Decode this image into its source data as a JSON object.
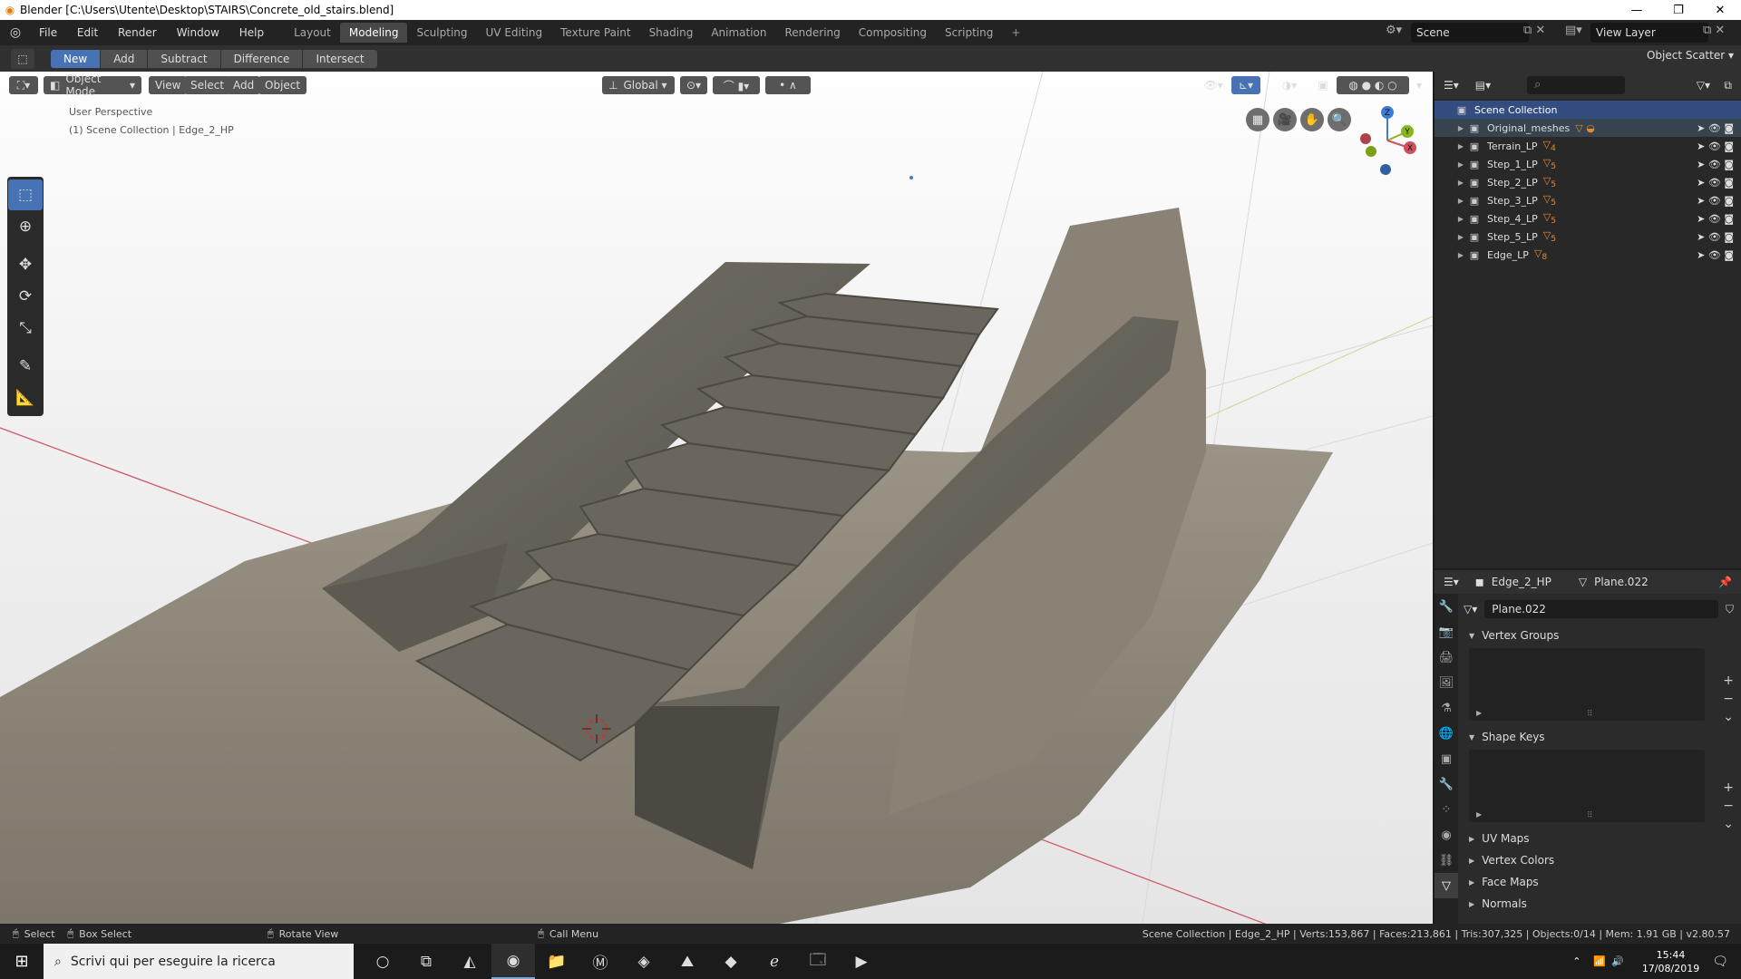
{
  "window": {
    "title": "Blender [C:\\Users\\Utente\\Desktop\\STAIRS\\Concrete_old_stairs.blend]",
    "controls": [
      "—",
      "❐",
      "✕"
    ]
  },
  "menu": [
    "File",
    "Edit",
    "Render",
    "Window",
    "Help"
  ],
  "workspaces": [
    {
      "label": "Layout",
      "active": false
    },
    {
      "label": "Modeling",
      "active": true
    },
    {
      "label": "Sculpting",
      "active": false
    },
    {
      "label": "UV Editing",
      "active": false
    },
    {
      "label": "Texture Paint",
      "active": false
    },
    {
      "label": "Shading",
      "active": false
    },
    {
      "label": "Animation",
      "active": false
    },
    {
      "label": "Rendering",
      "active": false
    },
    {
      "label": "Compositing",
      "active": false
    },
    {
      "label": "Scripting",
      "active": false
    }
  ],
  "workspace_add": "+",
  "scene": "Scene",
  "view_layer": "View Layer",
  "tool_header": {
    "boolean_ops": [
      "New",
      "Add",
      "Subtract",
      "Difference",
      "Intersect"
    ],
    "active_op": "New",
    "addon_label": "Object Scatter"
  },
  "viewport": {
    "mode": "Object Mode",
    "menus": [
      "View",
      "Select",
      "Add",
      "Object"
    ],
    "orientation": "Global",
    "perspective_label": "User Perspective",
    "context_label": "(1) Scene Collection | Edge_2_HP",
    "gizmo_axes": {
      "x": "X",
      "y": "Y",
      "z": "Z"
    },
    "colors": {
      "x_axis": "#d05060",
      "y_axis": "#8ab51f",
      "z_axis": "#3d7bd6",
      "stone": "#6f6b62",
      "terrain": "#8d8677"
    }
  },
  "tools": [
    "select-box",
    "cursor",
    "move",
    "rotate",
    "scale",
    "annotate",
    "measure"
  ],
  "outliner": {
    "root": "Scene Collection",
    "items": [
      {
        "name": "Original_meshes",
        "badge": "",
        "selected": true
      },
      {
        "name": "Terrain_LP",
        "badge": "4"
      },
      {
        "name": "Step_1_LP",
        "badge": "5"
      },
      {
        "name": "Step_2_LP",
        "badge": "5"
      },
      {
        "name": "Step_3_LP",
        "badge": "5"
      },
      {
        "name": "Step_4_LP",
        "badge": "5"
      },
      {
        "name": "Step_5_LP",
        "badge": "5"
      },
      {
        "name": "Edge_LP",
        "badge": "8"
      }
    ]
  },
  "properties": {
    "object_name": "Edge_2_HP",
    "mesh_name": "Plane.022",
    "data_field": "Plane.022",
    "panels": [
      {
        "label": "Vertex Groups",
        "open": true
      },
      {
        "label": "Shape Keys",
        "open": true
      },
      {
        "label": "UV Maps",
        "open": false
      },
      {
        "label": "Vertex Colors",
        "open": false
      },
      {
        "label": "Face Maps",
        "open": false
      },
      {
        "label": "Normals",
        "open": false
      }
    ]
  },
  "statusbar": {
    "select": "Select",
    "box_select": "Box Select",
    "rotate_view": "Rotate View",
    "call_menu": "Call Menu",
    "stats": "Scene Collection | Edge_2_HP | Verts:153,867 | Faces:213,861 | Tris:307,325 | Objects:0/14 | Mem: 1.91 GB | v2.80.57"
  },
  "taskbar": {
    "search_placeholder": "Scrivi qui per eseguire la ricerca",
    "time": "15:44",
    "date": "17/08/2019"
  }
}
